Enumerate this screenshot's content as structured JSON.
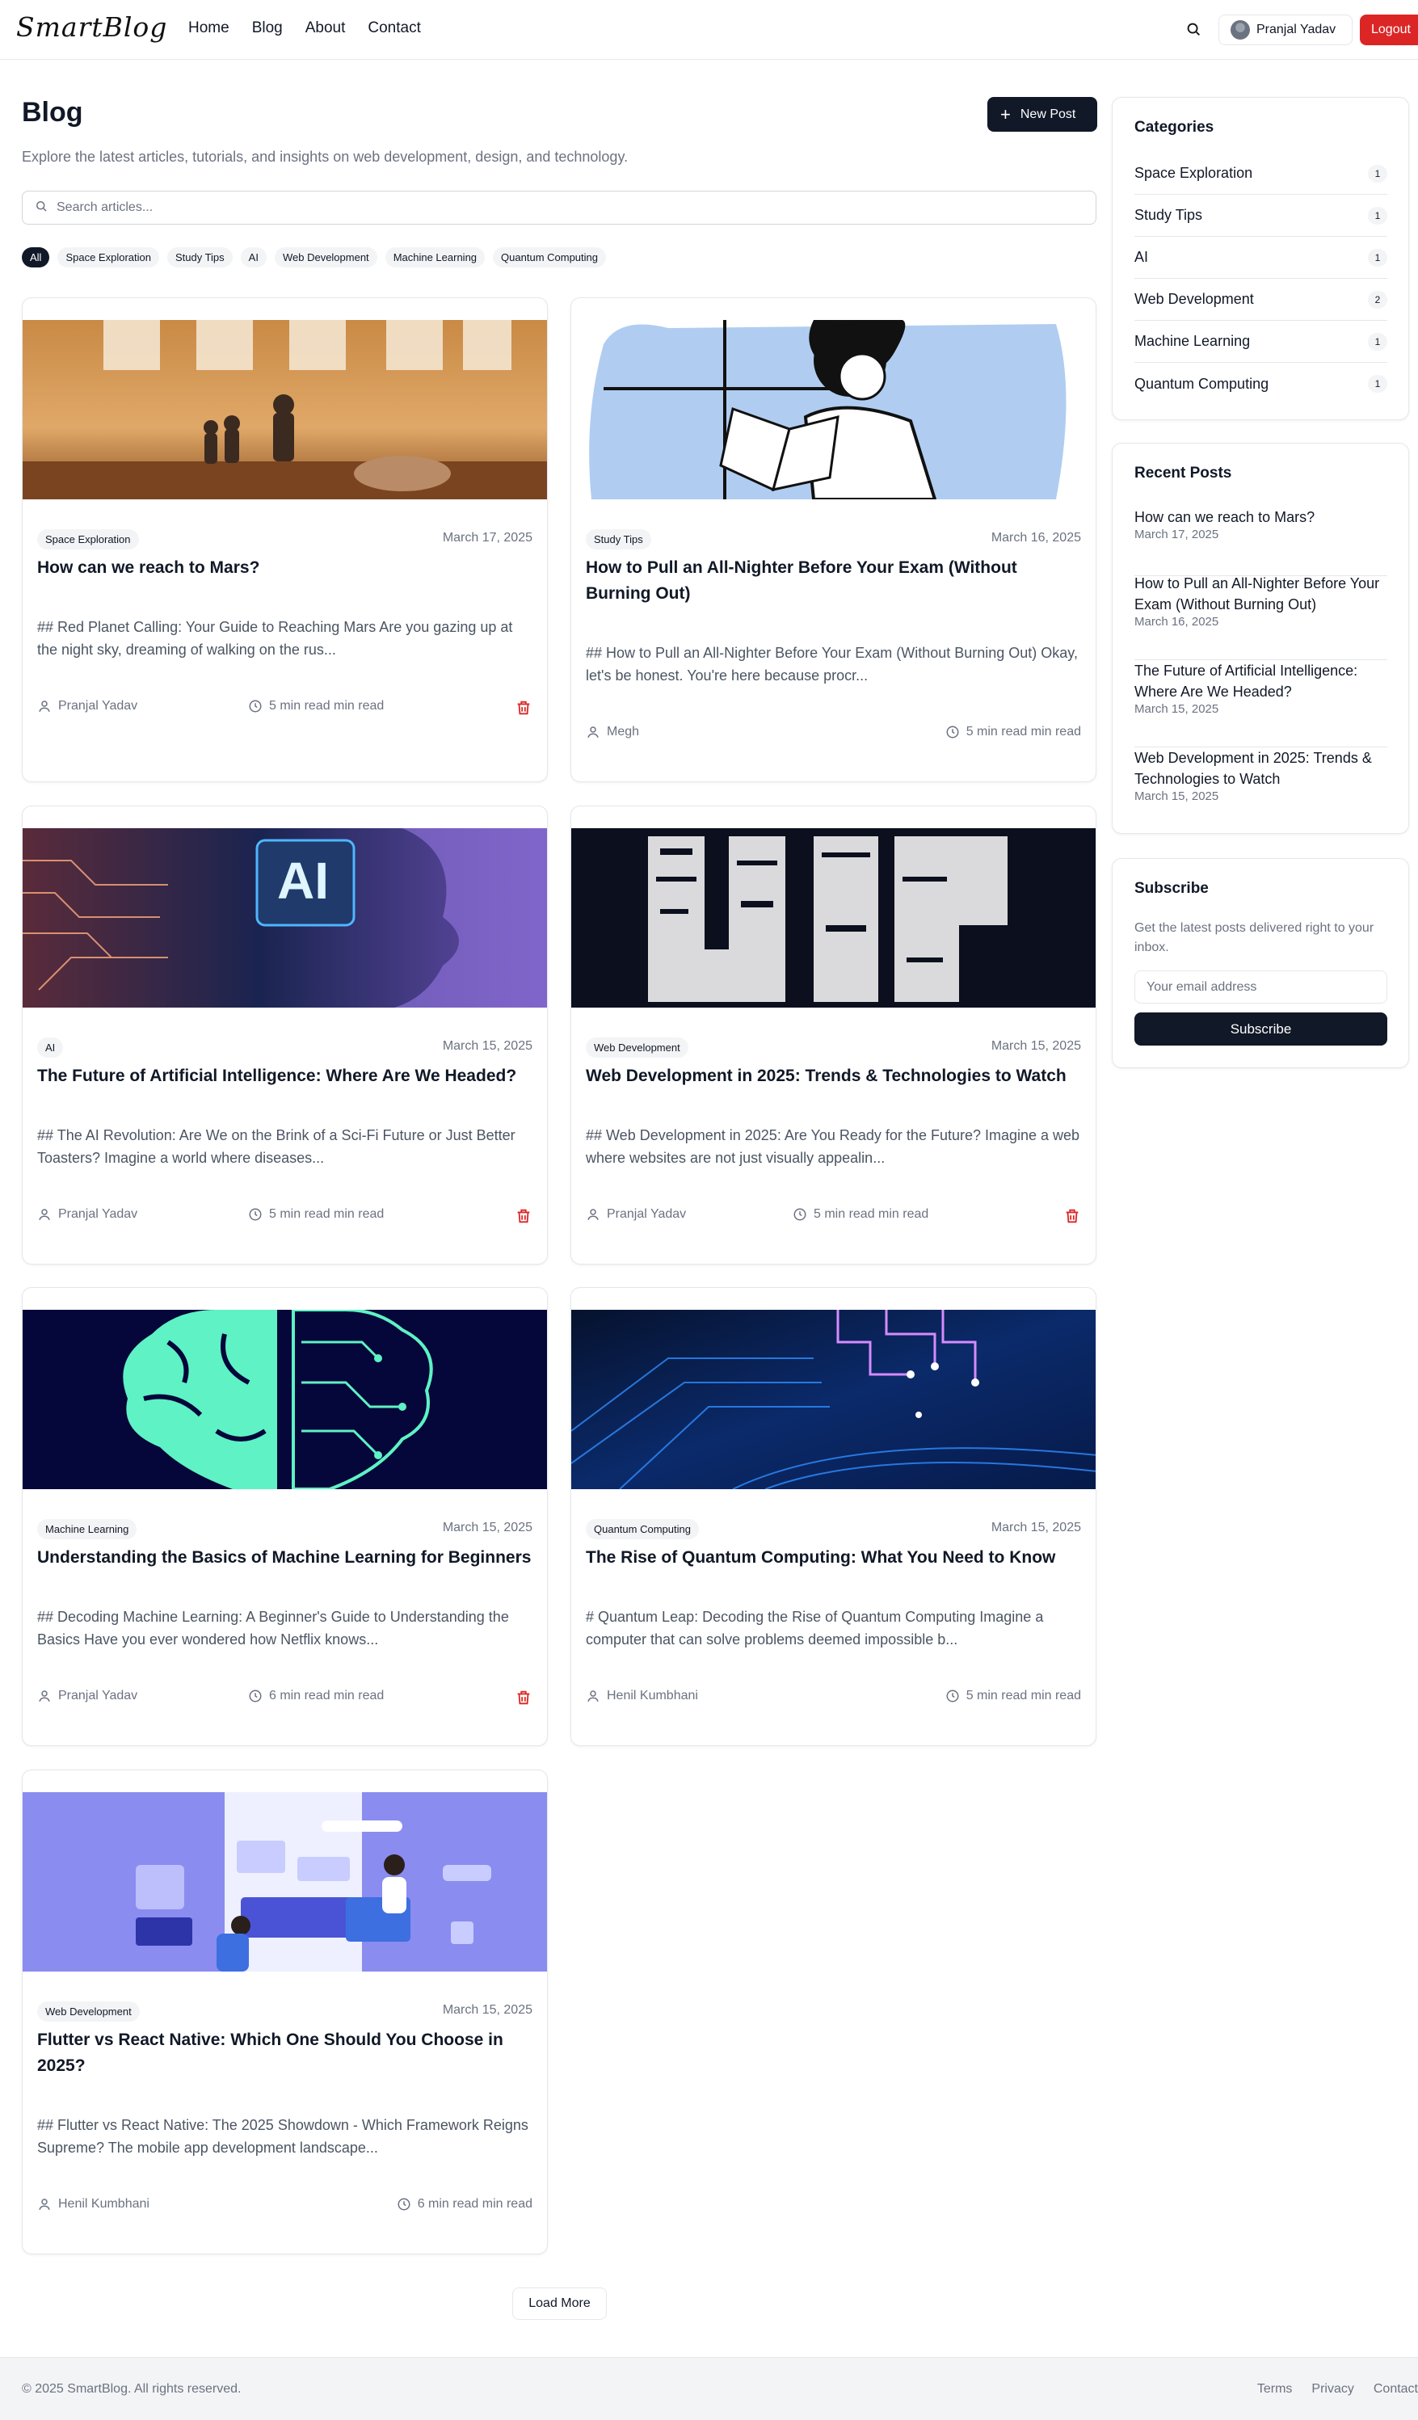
{
  "header": {
    "logo": "SmartBlog",
    "nav": [
      "Home",
      "Blog",
      "About",
      "Contact"
    ],
    "user_name": "Pranjal Yadav",
    "logout": "Logout"
  },
  "page": {
    "title": "Blog",
    "subtitle": "Explore the latest articles, tutorials, and insights on web development, design, and technology.",
    "new_post": "New Post",
    "search_placeholder": "Search articles...",
    "filters": [
      "All",
      "Space Exploration",
      "Study Tips",
      "AI",
      "Web Development",
      "Machine Learning",
      "Quantum Computing"
    ]
  },
  "posts": [
    {
      "tag": "Space Exploration",
      "date": "March 17, 2025",
      "title": "How can we reach to Mars?",
      "excerpt": "## Red Planet Calling: Your Guide to Reaching Mars Are you gazing up at the night sky, dreaming of walking on the rus...",
      "author": "Pranjal Yadav",
      "read": "5 min read min read"
    },
    {
      "tag": "Study Tips",
      "date": "March 16, 2025",
      "title": "How to Pull an All-Nighter Before Your Exam (Without Burning Out)",
      "excerpt": "## How to Pull an All-Nighter Before Your Exam (Without Burning Out) Okay, let's be honest. You're here because procr...",
      "author": "Megh",
      "read": "5 min read min read"
    },
    {
      "tag": "AI",
      "date": "March 15, 2025",
      "title": "The Future of Artificial Intelligence: Where Are We Headed?",
      "excerpt": "## The AI Revolution: Are We on the Brink of a Sci-Fi Future or Just Better Toasters? Imagine a world where diseases...",
      "author": "Pranjal Yadav",
      "read": "5 min read min read"
    },
    {
      "tag": "Web Development",
      "date": "March 15, 2025",
      "title": "Web Development in 2025: Trends & Technologies to Watch",
      "excerpt": "## Web Development in 2025: Are You Ready for the Future? Imagine a web where websites are not just visually appealin...",
      "author": "Pranjal Yadav",
      "read": "5 min read min read"
    },
    {
      "tag": "Machine Learning",
      "date": "March 15, 2025",
      "title": "Understanding the Basics of Machine Learning for Beginners",
      "excerpt": "## Decoding Machine Learning: A Beginner's Guide to Understanding the Basics Have you ever wondered how Netflix knows...",
      "author": "Pranjal Yadav",
      "read": "6 min read min read"
    },
    {
      "tag": "Quantum Computing",
      "date": "March 15, 2025",
      "title": "The Rise of Quantum Computing: What You Need to Know",
      "excerpt": "# Quantum Leap: Decoding the Rise of Quantum Computing Imagine a computer that can solve problems deemed impossible b...",
      "author": "Henil Kumbhani",
      "read": "5 min read min read"
    },
    {
      "tag": "Web Development",
      "date": "March 15, 2025",
      "title": "Flutter vs React Native: Which One Should You Choose in 2025?",
      "excerpt": "## Flutter vs React Native: The 2025 Showdown - Which Framework Reigns Supreme? The mobile app development landscape...",
      "author": "Henil Kumbhani",
      "read": "6 min read min read"
    }
  ],
  "sidebar": {
    "categories_title": "Categories",
    "categories": [
      {
        "name": "Space Exploration",
        "count": "1"
      },
      {
        "name": "Study Tips",
        "count": "1"
      },
      {
        "name": "AI",
        "count": "1"
      },
      {
        "name": "Web Development",
        "count": "2"
      },
      {
        "name": "Machine Learning",
        "count": "1"
      },
      {
        "name": "Quantum Computing",
        "count": "1"
      }
    ],
    "recent_title": "Recent Posts",
    "recent": [
      {
        "title": "How can we reach to Mars?",
        "date": "March 17, 2025"
      },
      {
        "title": "How to Pull an All-Nighter Before Your Exam (Without Burning Out)",
        "date": "March 16, 2025"
      },
      {
        "title": "The Future of Artificial Intelligence: Where Are We Headed?",
        "date": "March 15, 2025"
      },
      {
        "title": "Web Development in 2025: Trends & Technologies to Watch",
        "date": "March 15, 2025"
      }
    ],
    "subscribe_title": "Subscribe",
    "subscribe_desc": "Get the latest posts delivered right to your inbox.",
    "email_placeholder": "Your email address",
    "subscribe_button": "Subscribe"
  },
  "load_more": "Load More",
  "footer": {
    "copyright": "© 2025 SmartBlog. All rights reserved.",
    "links": [
      "Terms",
      "Privacy",
      "Contact"
    ]
  },
  "colors": {
    "accent": "#111827",
    "logout": "#dc2626",
    "trash": "#dc2626"
  }
}
